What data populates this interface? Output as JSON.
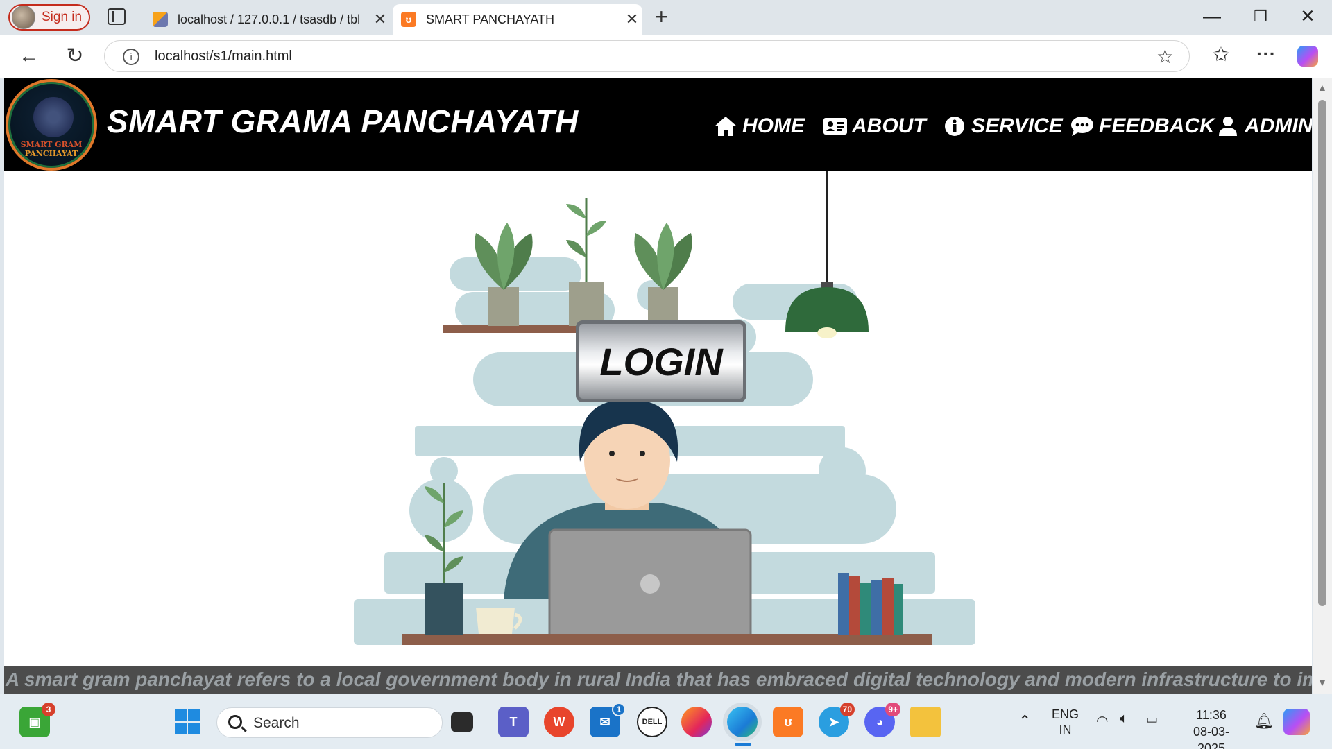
{
  "browser": {
    "signin_label": "Sign in",
    "tabs": [
      {
        "title": "localhost / 127.0.0.1 / tsasdb / tbl",
        "favicon": "phpmyadmin-icon"
      },
      {
        "title": "SMART PANCHAYATH",
        "favicon": "xampp-icon"
      }
    ],
    "url": "localhost/s1/main.html"
  },
  "site": {
    "logo_line1": "SMART GRAM",
    "logo_line2": "PANCHAYAT",
    "title": "SMART GRAMA PANCHAYATH",
    "menu": [
      {
        "label": "HOME",
        "icon": "home-icon"
      },
      {
        "label": "ABOUT",
        "icon": "id-card-icon"
      },
      {
        "label": "SERVICE",
        "icon": "info-icon"
      },
      {
        "label": "FEEDBACK",
        "icon": "chat-icon"
      },
      {
        "label": "ADMIN",
        "icon": "user-icon"
      }
    ],
    "login_label": "LOGIN",
    "caption": "A smart gram panchayat refers to a local government body in rural India that has embraced digital technology and modern infrastructure to improve"
  },
  "taskbar": {
    "search_label": "Search",
    "lang_line1": "ENG",
    "lang_line2": "IN",
    "time": "11:36",
    "date": "08-03-2025",
    "badges": {
      "widgets": "3",
      "mail": "1",
      "telegram": "70",
      "discord": "9+"
    }
  },
  "colors": {
    "header_bg": "#000000",
    "caption_bg": "#4c4c4c",
    "accent_red": "#c42b1c",
    "illustration_blue": "#c3dade"
  }
}
